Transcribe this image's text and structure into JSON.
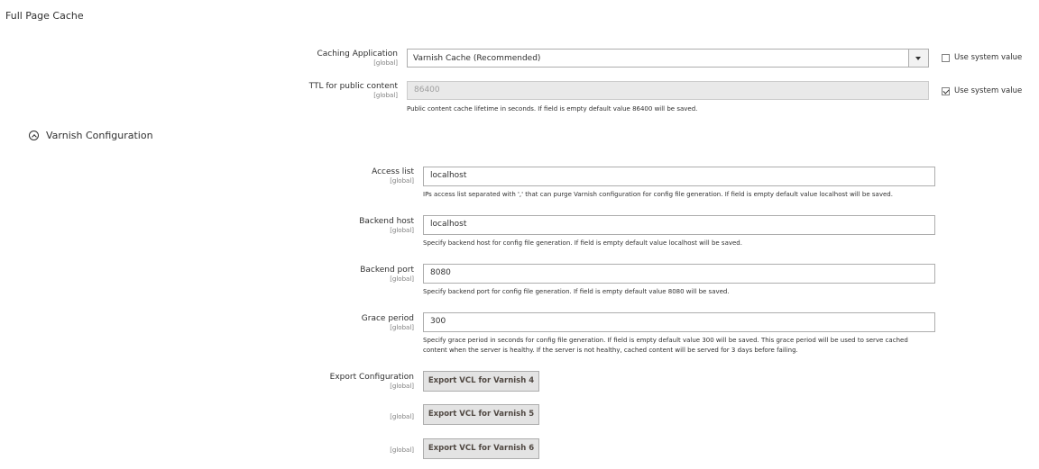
{
  "section": {
    "title": "Full Page Cache"
  },
  "caching_application": {
    "label": "Caching Application",
    "scope": "[global]",
    "value": "Varnish Cache (Recommended)",
    "use_system_value": {
      "label": "Use system value",
      "checked": false
    }
  },
  "ttl": {
    "label": "TTL for public content",
    "scope": "[global]",
    "value": "86400",
    "note": "Public content cache lifetime in seconds. If field is empty default value 86400 will be saved.",
    "use_system_value": {
      "label": "Use system value",
      "checked": true
    }
  },
  "varnish_group": {
    "title": "Varnish Configuration",
    "icon": "collapse-up-icon"
  },
  "access_list": {
    "label": "Access list",
    "scope": "[global]",
    "value": "localhost",
    "note": "IPs access list separated with ',' that can purge Varnish configuration for config file generation. If field is empty default value localhost will be saved."
  },
  "backend_host": {
    "label": "Backend host",
    "scope": "[global]",
    "value": "localhost",
    "note": "Specify backend host for config file generation. If field is empty default value localhost will be saved."
  },
  "backend_port": {
    "label": "Backend port",
    "scope": "[global]",
    "value": "8080",
    "note": "Specify backend port for config file generation. If field is empty default value 8080 will be saved."
  },
  "grace_period": {
    "label": "Grace period",
    "scope": "[global]",
    "value": "300",
    "note_line1": "Specify grace period in seconds for config file generation. If field is empty default value 300 will be saved. This grace period will be used to serve cached",
    "note_line2": "content when the server is healthy. If the server is not healthy, cached content will be served for 3 days before failing."
  },
  "export": {
    "label": "Export Configuration",
    "scope": "[global]",
    "buttons": [
      {
        "label": "Export VCL for Varnish 4",
        "scope": "[global]"
      },
      {
        "label": "Export VCL for Varnish 5",
        "scope": "[global]"
      },
      {
        "label": "Export VCL for Varnish 6",
        "scope": "[global]"
      }
    ]
  }
}
